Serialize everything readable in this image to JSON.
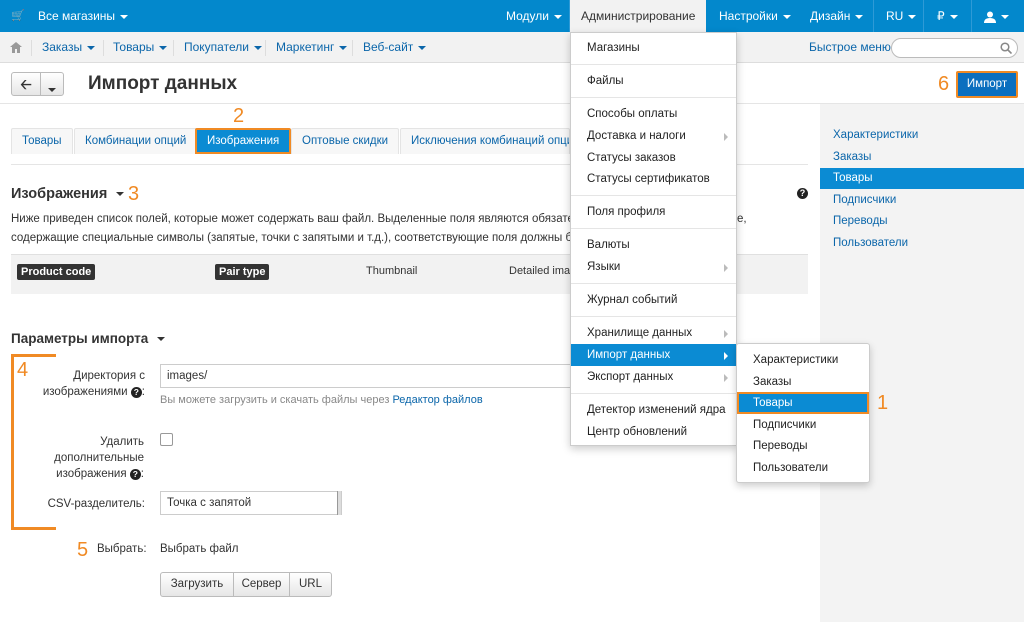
{
  "topbar": {
    "store": "Все магазины",
    "items": [
      "Модули",
      "Администрирование",
      "Настройки",
      "Дизайн",
      "RU",
      "₽"
    ]
  },
  "navbar": {
    "items": [
      "Заказы",
      "Товары",
      "Покупатели",
      "Маркетинг",
      "Веб-сайт"
    ],
    "quick_menu": "Быстрое меню",
    "search_placeholder": ""
  },
  "page": {
    "title": "Импорт данных",
    "import_button": "Импорт"
  },
  "tabs": [
    "Товары",
    "Комбинации опций",
    "Изображения",
    "Оптовые скидки",
    "Исключения комбинаций опций"
  ],
  "images_section": {
    "title": "Изображения",
    "description_line1": "Ниже приведен список полей, которые может содержать ваш файл. Выделенные поля являются обязатель",
    "description_line1_right": "е,",
    "description_line2": "содержащие специальные символы (запятые, точки с запятыми и т.д.), соответствующие поля должны быть з",
    "fields": [
      "Product code",
      "Pair type",
      "Thumbnail",
      "Detailed imag"
    ]
  },
  "import_params": {
    "title": "Параметры импорта",
    "dir_label_1": "Директория с",
    "dir_label_2": "изображениями",
    "dir_value": "images/",
    "dir_hint": "Вы можете загрузить и скачать файлы через",
    "dir_hint_link": "Редактор файлов",
    "delete_label_1": "Удалить дополнительные",
    "delete_label_2": "изображения",
    "csv_label": "CSV-разделитель:",
    "csv_value": "Точка с запятой",
    "choose_label": "Выбрать:",
    "choose_value": "Выбрать файл",
    "upload_buttons": [
      "Загрузить",
      "Сервер",
      "URL"
    ]
  },
  "sidebar": {
    "items": [
      "Характеристики",
      "Заказы",
      "Товары",
      "Подписчики",
      "Переводы",
      "Пользователи"
    ],
    "active": "Товары"
  },
  "admin_menu": {
    "items": [
      "Магазины",
      "Файлы",
      "Способы оплаты",
      "Доставка и налоги",
      "Статусы заказов",
      "Статусы сертификатов",
      "Поля профиля",
      "Валюты",
      "Языки",
      "Журнал событий",
      "Хранилище данных",
      "Импорт данных",
      "Экспорт данных",
      "Детектор изменений ядра",
      "Центр обновлений"
    ]
  },
  "import_submenu": {
    "items": [
      "Характеристики",
      "Заказы",
      "Товары",
      "Подписчики",
      "Переводы",
      "Пользователи"
    ]
  },
  "annotations": [
    "1",
    "2",
    "3",
    "4",
    "5",
    "6"
  ],
  "colors": {
    "topbar": "#0388cc",
    "accent": "#0b8bd3",
    "annotation": "#f08a24"
  }
}
